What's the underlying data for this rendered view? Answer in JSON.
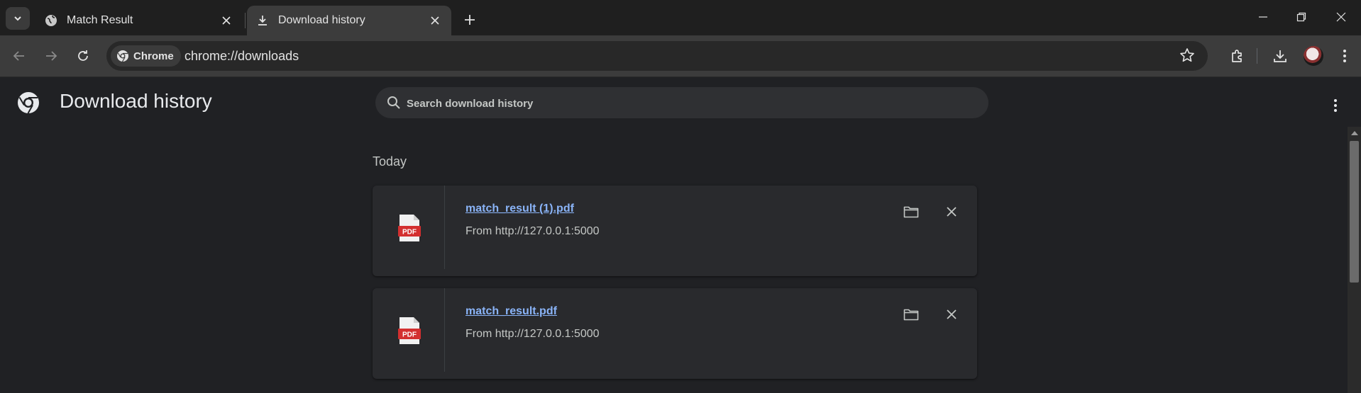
{
  "tabs": [
    {
      "title": "Match Result",
      "icon": "globe-icon",
      "active": false
    },
    {
      "title": "Download history",
      "icon": "download-icon",
      "active": true
    }
  ],
  "toolbar": {
    "chip_label": "Chrome",
    "url": "chrome://downloads"
  },
  "page": {
    "title": "Download history",
    "search_placeholder": "Search download history",
    "section_label": "Today"
  },
  "downloads": [
    {
      "filename": "match_result (1).pdf",
      "source": "From http://127.0.0.1:5000",
      "file_type": "PDF"
    },
    {
      "filename": "match_result.pdf",
      "source": "From http://127.0.0.1:5000",
      "file_type": "PDF"
    }
  ],
  "colors": {
    "background": "#202124",
    "card": "#292a2d",
    "link": "#8ab4f8",
    "pdf_red": "#d32f2f"
  }
}
